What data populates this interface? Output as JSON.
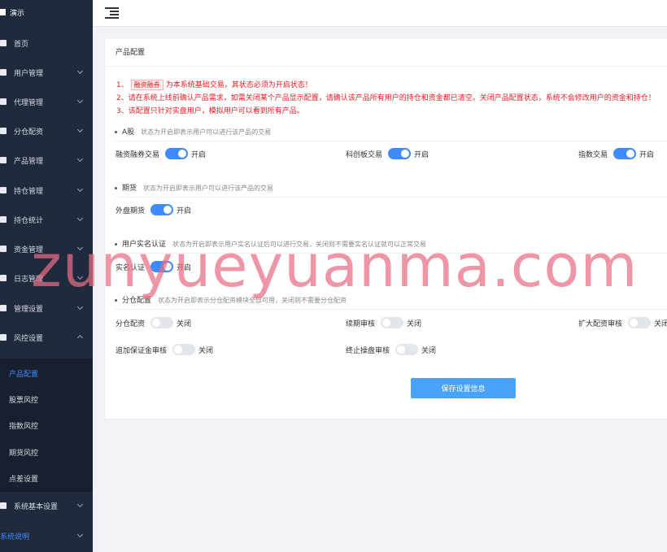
{
  "sidebar": {
    "brand": "演示",
    "items": [
      {
        "label": "首页",
        "icon": "home-icon"
      },
      {
        "label": "用户管理",
        "icon": "users-icon"
      },
      {
        "label": "代理管理",
        "icon": "agent-icon"
      },
      {
        "label": "分仓配资",
        "icon": "allocation-icon"
      },
      {
        "label": "产品管理",
        "icon": "product-icon"
      },
      {
        "label": "持仓管理",
        "icon": "position-icon"
      },
      {
        "label": "持仓统计",
        "icon": "stats-icon"
      },
      {
        "label": "资金管理",
        "icon": "funds-icon"
      },
      {
        "label": "日志管理",
        "icon": "log-icon"
      },
      {
        "label": "管理设置",
        "icon": "admin-settings-icon"
      },
      {
        "label": "风控设置",
        "icon": "risk-icon"
      }
    ],
    "submenu": [
      {
        "label": "产品配置",
        "active": true
      },
      {
        "label": "股票风控"
      },
      {
        "label": "指数风控"
      },
      {
        "label": "期货风控"
      },
      {
        "label": "点差设置"
      }
    ],
    "bottom_items": [
      {
        "label": "系统基本设置"
      },
      {
        "label": "系统说明"
      }
    ]
  },
  "card": {
    "title": "产品配置",
    "warnings": {
      "w1_prefix": "1、",
      "w1_tag": "融资融券",
      "w1_text": "为本系统基础交易，其状态必须为开启状态！",
      "w2": "2、请在系统上线前确认产品需求，如需关闭某个产品显示配置，请确认该产品所有用户的持仓和资金都已清空。关闭产品配置状态，系统不会修改用户的资金和持仓！",
      "w3": "3、该配置只针对实盘用户，模拟用户可以看到所有产品。"
    },
    "sections": {
      "a_stock": {
        "title": "A股",
        "desc": "状态为开启即表示用户可以进行该产品的交易"
      },
      "futures": {
        "title": "期货",
        "desc": "状态为开启即表示用户可以进行该产品的交易"
      },
      "realname": {
        "title": "用户实名认证",
        "desc": "状态为开启即表示用户实名认证后可以进行交易，关闭则不需要实名认证就可以正常交易"
      },
      "allocation": {
        "title": "分仓配置",
        "desc": "状态为开启即表示分仓配资模块全部可用，关闭则不需要分仓配资"
      }
    },
    "fields": {
      "margin": {
        "label": "融资融券交易",
        "state": "开启"
      },
      "star": {
        "label": "科创板交易",
        "state": "开启"
      },
      "index": {
        "label": "指数交易",
        "state": "开启"
      },
      "foreign": {
        "label": "外盘期货",
        "state": "开启"
      },
      "realname": {
        "label": "实名认证",
        "state": "开启"
      },
      "alloc": {
        "label": "分仓配资",
        "state": "关闭"
      },
      "renew": {
        "label": "续期审核",
        "state": "关闭"
      },
      "expand": {
        "label": "扩大配资审核",
        "state": "关闭"
      },
      "margin_add": {
        "label": "追加保证金审核",
        "state": "关闭"
      },
      "terminate": {
        "label": "终止操盘审核",
        "state": "关闭"
      }
    },
    "save_label": "保存设置信息"
  },
  "watermark": "zunyueyuanma.com",
  "colors": {
    "sidebar_bg": "#1f2a3d",
    "accent": "#3d8bfd",
    "warning": "#e51c23",
    "button": "#4aa3fb"
  }
}
